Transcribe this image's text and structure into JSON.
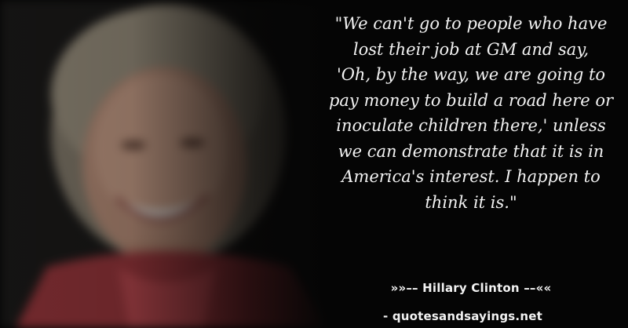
{
  "quote": {
    "text": "\"We can't go to people who have\nlost their job at GM and say,\n'Oh, by the way, we are going to\npay money to build a road here or\ninoculate children there,' unless\nwe can demonstrate that it is in\nAmerica's interest. I happen to\nthink it is.\""
  },
  "attribution": {
    "text": "»»–– Hillary Clinton ––««"
  },
  "source": {
    "text": "- quotesandsayings.net"
  },
  "colors": {
    "background": "#050505",
    "text": "#f2f2f2"
  }
}
